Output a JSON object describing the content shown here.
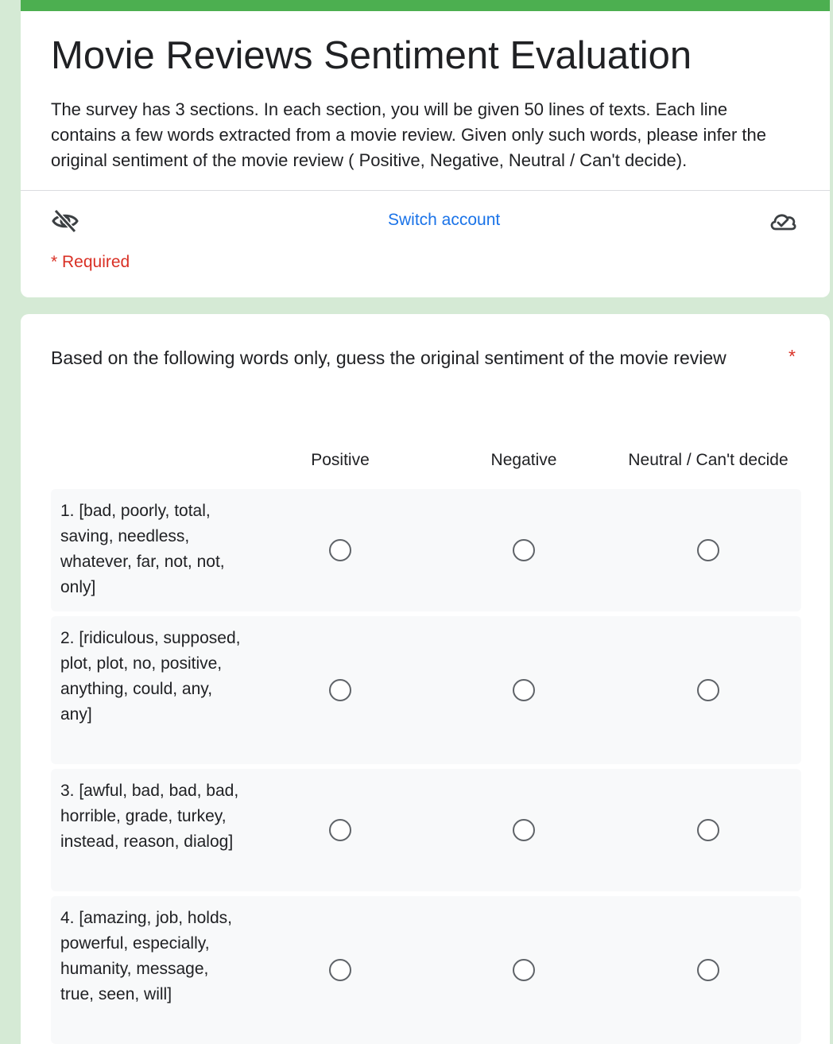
{
  "header": {
    "title": "Movie Reviews Sentiment Evaluation",
    "description": "The survey has 3 sections. In each section, you will be given 50 lines of texts. Each line contains a few words extracted from a movie review. Given only such words, please infer the original sentiment of the movie review ( Positive,  Negative,  Neutral / Can't decide).",
    "switch_account": "Switch account",
    "required_note": "* Required",
    "icons": [
      "eye-off-icon",
      "cloud-check-icon"
    ]
  },
  "colors": {
    "accent_green": "#4caf50",
    "background": "#d5ead5",
    "link_blue": "#1a73e8",
    "required_red": "#d93025"
  },
  "question": {
    "text": "Based on the following words only, guess the original sentiment of the movie review",
    "required_marker": "*",
    "columns": [
      "Positive",
      "Negative",
      "Neutral / Can't decide"
    ],
    "rows": [
      "1. [bad, poorly, total, saving, needless, whatever, far, not, not, only]",
      "2. [ridiculous, supposed, plot, plot, no, positive, anything, could, any, any]",
      "3. [awful, bad, bad, bad, horrible, grade, turkey, instead, reason, dialog]",
      "4. [amazing, job, holds, powerful, especially, humanity, message, true, seen, will]"
    ]
  }
}
